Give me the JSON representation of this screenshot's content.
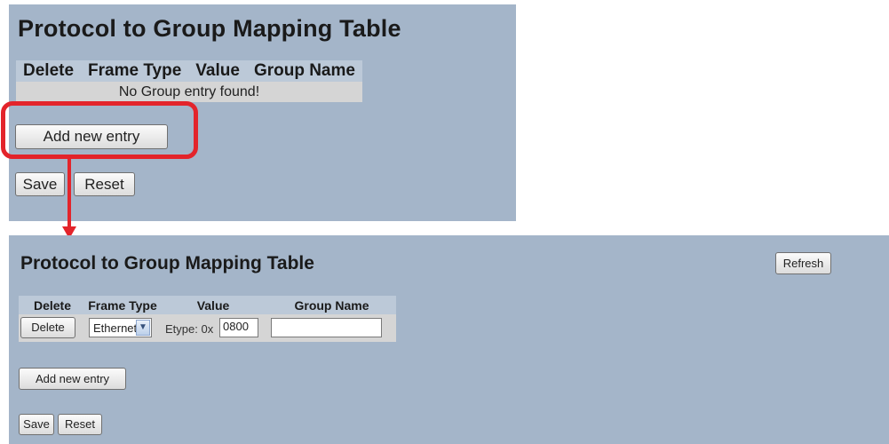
{
  "before": {
    "title": "Protocol to Group Mapping Table",
    "columns": [
      "Delete",
      "Frame Type",
      "Value",
      "Group Name"
    ],
    "empty_message": "No Group entry found!",
    "add_label": "Add new entry",
    "save_label": "Save",
    "reset_label": "Reset"
  },
  "annotation": {
    "color": "#e3242b"
  },
  "after": {
    "title": "Protocol to Group Mapping Table",
    "refresh_label": "Refresh",
    "columns": [
      "Delete",
      "Frame Type",
      "Value",
      "Group Name"
    ],
    "row": {
      "delete_label": "Delete",
      "frame_type": "Ethernet",
      "etype_prefix": "Etype: 0x",
      "etype_value": "0800",
      "group_name": ""
    },
    "add_label": "Add new entry",
    "save_label": "Save",
    "reset_label": "Reset"
  },
  "colors": {
    "panel": "#a4b5c9",
    "header": "#bcc9d8",
    "row": "#d5d5d5"
  }
}
